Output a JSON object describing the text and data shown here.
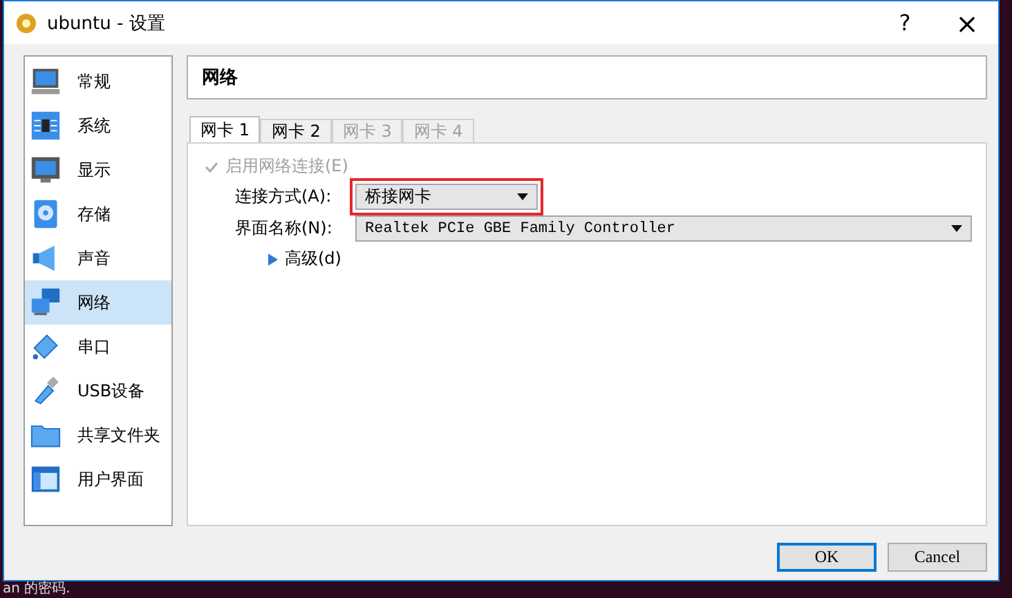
{
  "window": {
    "title": "ubuntu - 设置",
    "help": "?",
    "close": "×"
  },
  "sidebar": {
    "items": [
      {
        "label": "常规",
        "kind": "monitor",
        "selected": false
      },
      {
        "label": "系统",
        "kind": "chip",
        "selected": false
      },
      {
        "label": "显示",
        "kind": "display",
        "selected": false
      },
      {
        "label": "存储",
        "kind": "disk",
        "selected": false
      },
      {
        "label": "声音",
        "kind": "speaker",
        "selected": false
      },
      {
        "label": "网络",
        "kind": "network",
        "selected": true
      },
      {
        "label": "串口",
        "kind": "serial",
        "selected": false
      },
      {
        "label": "USB设备",
        "kind": "usb",
        "selected": false
      },
      {
        "label": "共享文件夹",
        "kind": "folder",
        "selected": false
      },
      {
        "label": "用户界面",
        "kind": "window",
        "selected": false
      }
    ]
  },
  "header": "网络",
  "tabs": [
    {
      "label": "网卡 1",
      "selected": true,
      "disabled": false
    },
    {
      "label": "网卡 2",
      "selected": false,
      "disabled": false
    },
    {
      "label": "网卡 3",
      "selected": false,
      "disabled": true
    },
    {
      "label": "网卡 4",
      "selected": false,
      "disabled": true
    }
  ],
  "enable": {
    "label": "启用网络连接(E)",
    "checked": true,
    "disabled": true
  },
  "fields": [
    {
      "label": "连接方式(A):",
      "value": "桥接网卡",
      "highlighted": true
    },
    {
      "label": "界面名称(N):",
      "value": "Realtek PCIe GBE Family Controller",
      "highlighted": false
    }
  ],
  "advanced": {
    "label": "高级(d)",
    "expanded": false
  },
  "buttons": [
    {
      "label": "OK",
      "default": true
    },
    {
      "label": "Cancel",
      "default": false
    }
  ],
  "background_text": "an 的密码."
}
